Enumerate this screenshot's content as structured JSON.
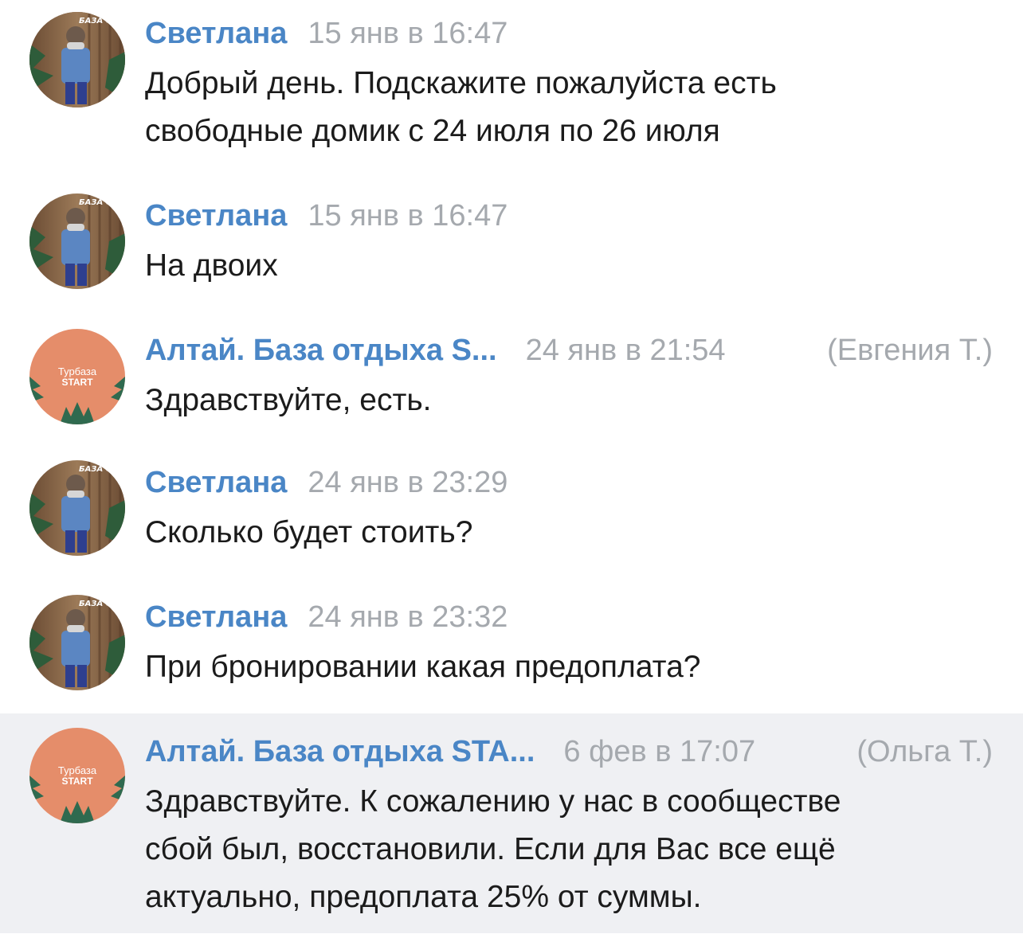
{
  "messages": [
    {
      "author": "Светлана",
      "time": "15 янв в 16:47",
      "staff": "",
      "text_lines": [
        "Добрый день. Подскажите пожалуйста есть",
        "свободные домик с 24 июля по 26 июля"
      ],
      "avatar": "user-photo"
    },
    {
      "author": "Светлана",
      "time": "15 янв в 16:47",
      "staff": "",
      "text_lines": [
        "На двоих"
      ],
      "avatar": "user-photo"
    },
    {
      "author": "Алтай. База отдыха S...",
      "time": "24 янв в 21:54",
      "staff": "(Евгения Т.)",
      "text_lines": [
        "Здравствуйте, есть."
      ],
      "avatar": "community-logo"
    },
    {
      "author": "Светлана",
      "time": "24 янв в 23:29",
      "staff": "",
      "text_lines": [
        "Сколько будет стоить?"
      ],
      "avatar": "user-photo"
    },
    {
      "author": "Светлана",
      "time": "24 янв в 23:32",
      "staff": "",
      "text_lines": [
        "При бронировании какая предоплата?"
      ],
      "avatar": "user-photo"
    },
    {
      "author": "Алтай. База отдыха STA...",
      "time": "6 фев в 17:07",
      "staff": "(Ольга Т.)",
      "text_lines": [
        "Здравствуйте. К сожалению у нас в сообществе",
        "сбой был, восстановили. Если для Вас все ещё",
        "актуально, предоплата 25% от суммы."
      ],
      "avatar": "community-logo"
    }
  ],
  "avatars": {
    "user_sign_text": "БАЗА ОТДЫХА",
    "community_logo_top": "Турбаза",
    "community_logo_bottom": "START"
  },
  "colors": {
    "author": "#4a86c6",
    "meta": "#a5a9ae",
    "text": "#1b1b1b",
    "highlight_bg": "#eff0f3",
    "community_avatar_bg": "#e58d6a",
    "community_avatar_leaves": "#2f6a4f"
  }
}
